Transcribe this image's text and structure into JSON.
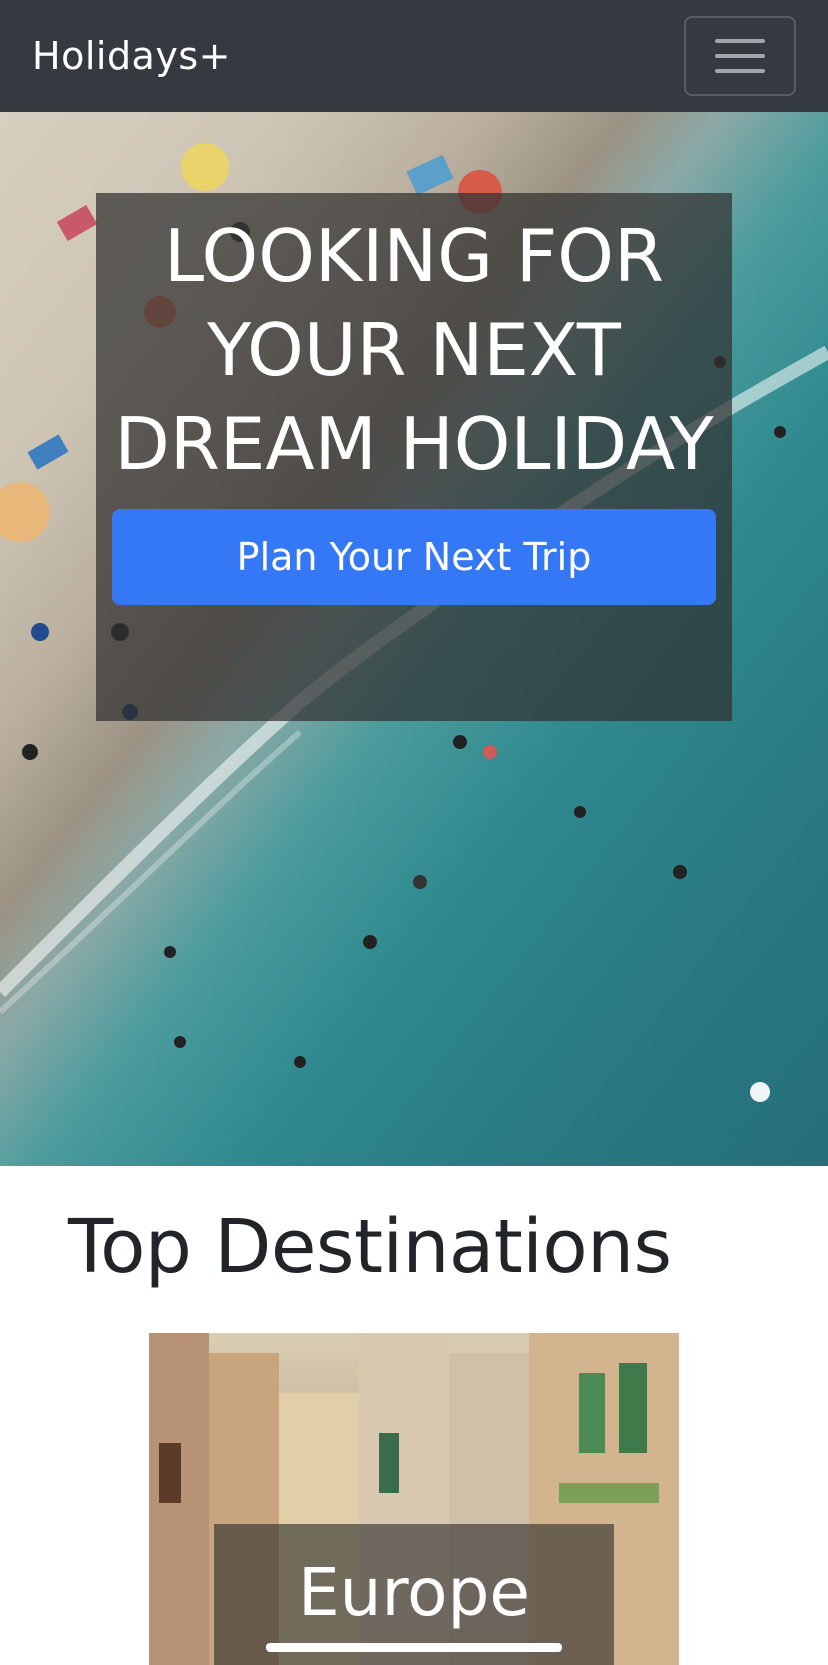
{
  "navbar": {
    "brand": "Holidays+",
    "toggler_icon": "hamburger-menu-icon"
  },
  "hero": {
    "title": "LOOKING FOR YOUR NEXT DREAM HOLIDAY",
    "cta_label": "Plan Your Next Trip",
    "image_subject": "aerial beach and sea"
  },
  "destinations": {
    "heading": "Top Destinations",
    "cards": [
      {
        "label": "Europe"
      }
    ]
  },
  "colors": {
    "navbar_bg": "#343a40",
    "primary": "#3478f6",
    "text_dark": "#212529"
  }
}
